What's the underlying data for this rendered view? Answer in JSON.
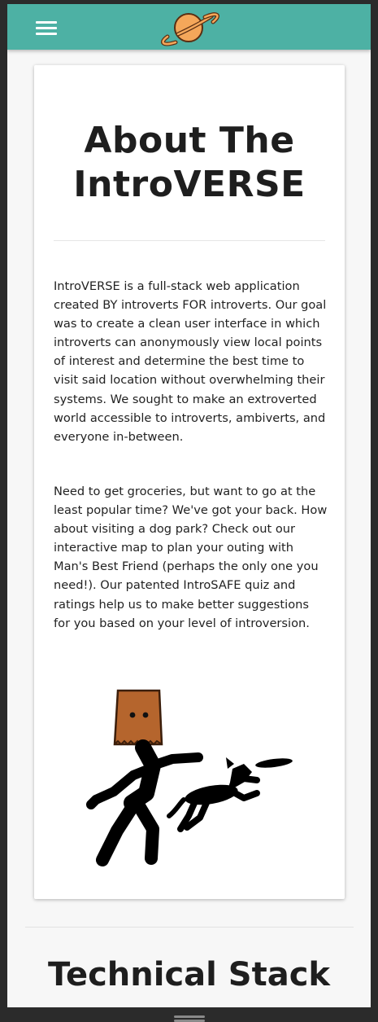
{
  "navbar": {
    "menu_icon": "hamburger-menu-icon",
    "logo_icon": "planet-logo-icon",
    "accent_color": "#4db1a4"
  },
  "about": {
    "title": "About The IntroVERSE",
    "paragraphs": [
      "IntroVERSE is a full-stack web application created BY introverts FOR introverts. Our goal was to create a clean user interface in which introverts can anonymously view local points of interest and determine the best time to visit said location without overwhelming their systems. We sought to make an extroverted world accessible to introverts, ambiverts, and everyone in-between.",
      "Need to get groceries, but want to go at the least popular time? We've got your back. How about visiting a dog park? Check out our interactive map to plan your outing with Man's Best Friend (perhaps the only one you need!). Our patented IntroSAFE quiz and ratings help us to make better suggestions for you based on your level of introversion."
    ],
    "illustration": "paper-bag-person-throwing-frisbee-to-dog"
  },
  "technical_stack": {
    "title": "Technical Stack"
  }
}
